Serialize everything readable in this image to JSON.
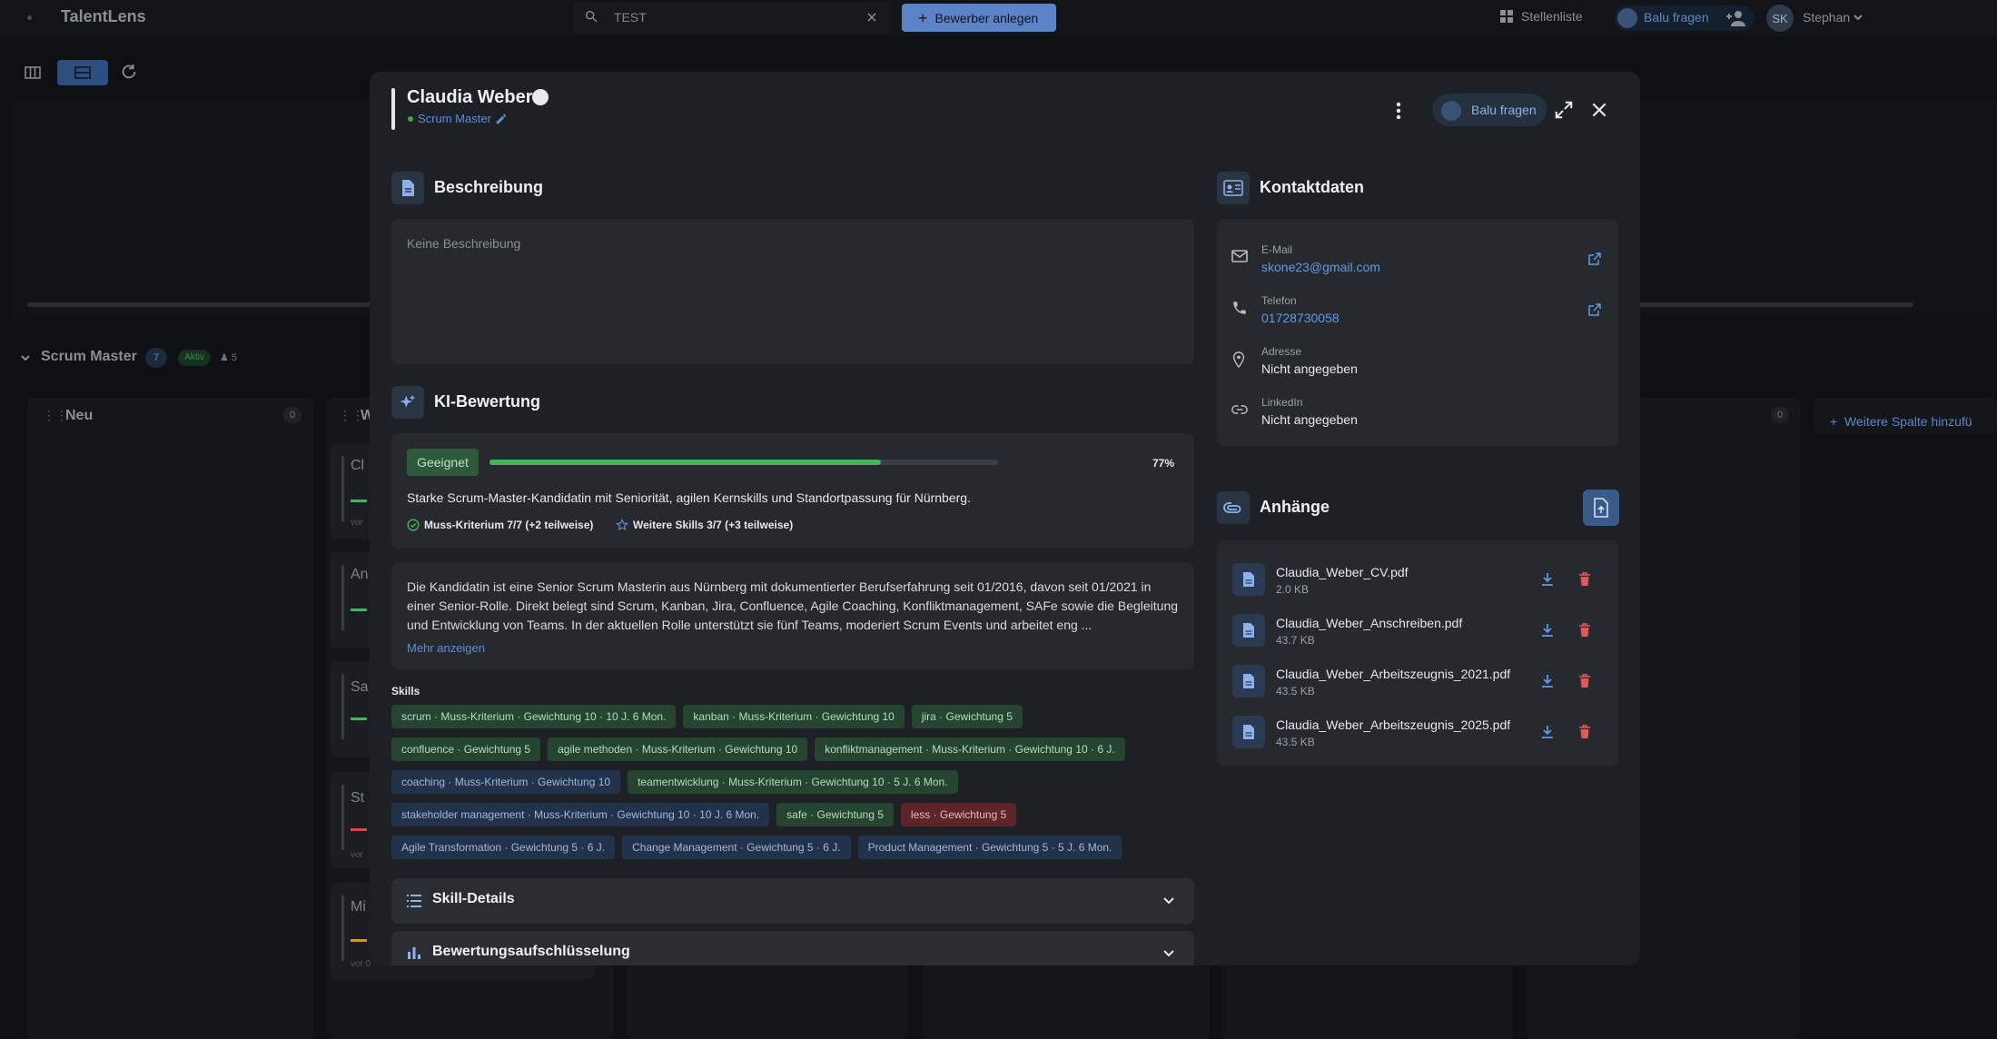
{
  "app": {
    "logo": "TalentLens"
  },
  "topbar": {
    "search_value": "TEST",
    "add_button": "Bewerber anlegen",
    "stellenliste": "Stellenliste",
    "balu": "Balu fragen",
    "user_initials": "SK",
    "user_name": "Stephan"
  },
  "board": {
    "title": "Scrum Master",
    "count": "7",
    "status": "Aktiv",
    "people": "5",
    "columns": [
      {
        "title": "Neu",
        "count": "0"
      },
      {
        "title": "W"
      },
      {
        "count": "0"
      }
    ],
    "add_column": "Weitere Spalte hinzufü",
    "cards": [
      {
        "initial": "Cl",
        "sub": "vor"
      },
      {
        "initial": "An",
        "sub": ""
      },
      {
        "initial": "Sa",
        "sub": ""
      },
      {
        "initial": "St",
        "sub": "vor"
      },
      {
        "initial": "Mi",
        "sub": "vor 0"
      }
    ]
  },
  "modal": {
    "name": "Claudia Weber",
    "role": "Scrum Master",
    "balu": "Balu fragen",
    "beschreibung": {
      "title": "Beschreibung",
      "text": "Keine Beschreibung"
    },
    "ki": {
      "title": "KI-Bewertung",
      "verdict": "Geeignet",
      "score": 77,
      "score_label": "77%",
      "summary": "Starke Scrum-Master-Kandidatin mit Seniorität, agilen Kernskills und Standortpassung für Nürnberg.",
      "must": "Muss-Kriterium 7/7 (+2 teilweise)",
      "more": "Weitere Skills 3/7 (+3 teilweise)",
      "long_text": "Die Kandidatin ist eine Senior Scrum Masterin aus Nürnberg mit dokumentierter Berufserfahrung seit 01/2016, davon seit 01/2021 in einer Senior-Rolle. Direkt belegt sind Scrum, Kanban, Jira, Confluence, Agile Coaching, Konfliktmanagement, SAFe sowie die Begleitung und Entwicklung von Teams. In der aktuellen Rolle unterstützt sie fünf Teams, moderiert Scrum Events und arbeitet eng ...",
      "show_more": "Mehr anzeigen"
    },
    "skills_label": "Skills",
    "skill_rows": [
      [
        {
          "text": "scrum · Muss-Kriterium · Gewichtung 10 · 10 J. 6 Mon.",
          "color": "green"
        },
        {
          "text": "kanban · Muss-Kriterium · Gewichtung 10",
          "color": "green"
        },
        {
          "text": "jira · Gewichtung 5",
          "color": "green"
        }
      ],
      [
        {
          "text": "confluence · Gewichtung 5",
          "color": "green"
        },
        {
          "text": "agile methoden · Muss-Kriterium · Gewichtung 10",
          "color": "green"
        },
        {
          "text": "konfliktmanagement · Muss-Kriterium · Gewichtung 10 · 6 J.",
          "color": "green"
        }
      ],
      [
        {
          "text": "coaching · Muss-Kriterium · Gewichtung 10",
          "color": "blue"
        },
        {
          "text": "teamentwicklung · Muss-Kriterium · Gewichtung 10 · 5 J. 6 Mon.",
          "color": "green"
        }
      ],
      [
        {
          "text": "stakeholder management · Muss-Kriterium · Gewichtung 10 · 10 J. 6 Mon.",
          "color": "blue"
        },
        {
          "text": "safe · Gewichtung 5",
          "color": "green"
        },
        {
          "text": "less · Gewichtung 5",
          "color": "red"
        }
      ],
      [
        {
          "text": "Agile Transformation · Gewichtung 5 · 6 J.",
          "color": "blue"
        },
        {
          "text": "Change Management · Gewichtung 5 · 6 J.",
          "color": "blue"
        },
        {
          "text": "Product Management · Gewichtung 5 · 5 J. 6 Mon.",
          "color": "blue"
        }
      ]
    ],
    "skill_details": "Skill-Details",
    "breakdown": "Bewertungsaufschlüsselung",
    "kontakt": {
      "title": "Kontaktdaten",
      "email_label": "E-Mail",
      "email": "skone23@gmail.com",
      "phone_label": "Telefon",
      "phone": "01728730058",
      "address_label": "Adresse",
      "address": "Nicht angegeben",
      "linkedin_label": "LinkedIn",
      "linkedin": "Nicht angegeben"
    },
    "anhaenge": {
      "title": "Anhänge",
      "files": [
        {
          "name": "Claudia_Weber_CV.pdf",
          "size": "2.0 KB"
        },
        {
          "name": "Claudia_Weber_Anschreiben.pdf",
          "size": "43.7 KB"
        },
        {
          "name": "Claudia_Weber_Arbeitszeugnis_2021.pdf",
          "size": "43.5 KB"
        },
        {
          "name": "Claudia_Weber_Arbeitszeugnis_2025.pdf",
          "size": "43.5 KB"
        }
      ]
    }
  },
  "colors": {
    "accent": "#5f8ed6",
    "success": "#3fb75c",
    "danger": "#e05a5a"
  }
}
